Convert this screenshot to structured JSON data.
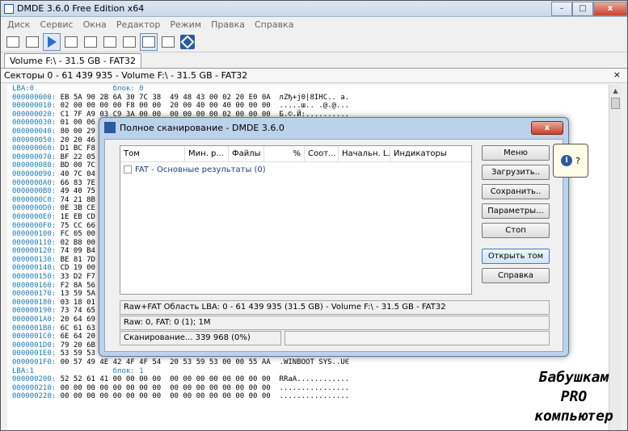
{
  "window": {
    "title": "DMDE 3.6.0 Free Edition x64"
  },
  "menu": [
    "Диск",
    "Сервис",
    "Окна",
    "Редактор",
    "Режим",
    "Правка",
    "Справка"
  ],
  "tab": {
    "label": "Volume F:\\ - 31.5 GB - FAT32"
  },
  "pathbar": {
    "text": "Секторы 0 - 61 439 935 - Volume F:\\ - 31.5 GB - FAT32",
    "close": "×"
  },
  "hex": [
    {
      "lba": true,
      "text": "LBA:0                  блок: 0"
    },
    {
      "off": "000000000:",
      "text": " EB 5A 90 2B 6A 30 7C 38  49 48 43 00 02 20 E0 0A  лZђ+j0|8IHC.. а."
    },
    {
      "off": "000000010:",
      "text": " 02 00 00 00 00 F8 00 00  20 00 40 00 40 00 00 00  .....ш.. .@.@..."
    },
    {
      "off": "000000020:",
      "text": " C1 7F A9 03 C9 3A 00 00  00 00 00 00 02 00 00 00  Б.©.Й:.........."
    },
    {
      "off": "000000030:",
      "text": " 01 00 06"
    },
    {
      "off": "000000040:",
      "text": " 80 00 29"
    },
    {
      "off": "000000050:",
      "text": " 20 20 46"
    },
    {
      "off": "000000060:",
      "text": " D1 BC F8"
    },
    {
      "off": "000000070:",
      "text": " BF 22 05"
    },
    {
      "off": "000000080:",
      "text": " BD 00 7C"
    },
    {
      "off": "000000090:",
      "text": " 40 7C 04"
    },
    {
      "off": "0000000A0:",
      "text": " 66 83 7E"
    },
    {
      "off": "0000000B0:",
      "text": " 49 40 75"
    },
    {
      "off": "0000000C0:",
      "text": " 74 21 8B"
    },
    {
      "off": "0000000D0:",
      "text": " 0E 3B CE"
    },
    {
      "off": "0000000E0:",
      "text": " 1E EB CD"
    },
    {
      "off": "0000000F0:",
      "text": " 75 CC 66"
    },
    {
      "off": "000000100:",
      "text": " FC 05 00"
    },
    {
      "off": "000000110:",
      "text": " 02 B8 00"
    },
    {
      "off": "000000120:",
      "text": " 74 09 B4"
    },
    {
      "off": "000000130:",
      "text": " BE 81 7D"
    },
    {
      "off": "000000140:",
      "text": " CD 19 00"
    },
    {
      "off": "000000150:",
      "text": " 33 D2 F7"
    },
    {
      "off": "000000160:",
      "text": " F2 8A 56"
    },
    {
      "off": "000000170:",
      "text": " 13 59 5A"
    },
    {
      "off": "000000180:",
      "text": " 03 18 01"
    },
    {
      "off": "000000190:",
      "text": " 73 74 65"
    },
    {
      "off": "0000001A0:",
      "text": " 20 64 69"
    },
    {
      "off": "0000001B0:",
      "text": " 6C 61 63"
    },
    {
      "off": "0000001C0:",
      "text": " 6E 64 20"
    },
    {
      "off": "0000001D0:",
      "text": " 79 20 6B 65 79 0D 0A 00  49 4F 20 20 20 20 20 20  y key...IO"
    },
    {
      "off": "0000001E0:",
      "text": " 53 59 53 4D 53 44 4F 53  20 20 20 53 59 53 80 01  SYSMSDOS   SYSЂ."
    },
    {
      "off": "0000001F0:",
      "text": " 00 57 49 4E 42 4F 4F 54  20 53 59 53 00 00 55 AA  .WINBOOT SYS..UЄ"
    },
    {
      "lba": true,
      "text": "LBA:1                  блок: 1"
    },
    {
      "off": "000000200:",
      "text": " 52 52 61 41 00 00 00 00  00 00 00 00 00 00 00 00  RRaA............"
    },
    {
      "off": "000000210:",
      "text": " 00 00 00 00 00 00 00 00  00 00 00 00 00 00 00 00  ................"
    },
    {
      "off": "000000220:",
      "text": " 00 00 00 00 00 00 00 00  00 00 00 00 00 00 00 00  ................"
    }
  ],
  "dialog": {
    "title": "Полное сканирование - DMDE 3.6.0",
    "close": "x",
    "columns": [
      "Том",
      "Мин. р...",
      "Файлы",
      "%",
      "Соот...",
      "Начальн. L...",
      "Индикаторы"
    ],
    "rows": [
      {
        "label": "FAT - Основные результаты (0)"
      }
    ],
    "buttons": [
      "Меню",
      "Загрузить..",
      "Сохранить..",
      "Параметры...",
      "Стоп",
      "Открыть том",
      "Справка"
    ],
    "status1": "Raw+FAT Область LBA: 0 - 61 439 935 (31.5 GB) - Volume F:\\ - 31.5 GB - FAT32",
    "status2": "Raw: 0, FAT: 0 (1); 1M",
    "status3": "Сканирование... 339 968 (0%)",
    "progress_percent": 0
  },
  "callout": {
    "icon": "info-icon",
    "text": "?"
  },
  "watermark": {
    "line1": "Бабушкам",
    "line2": "PRO",
    "line3": "компьютер"
  }
}
